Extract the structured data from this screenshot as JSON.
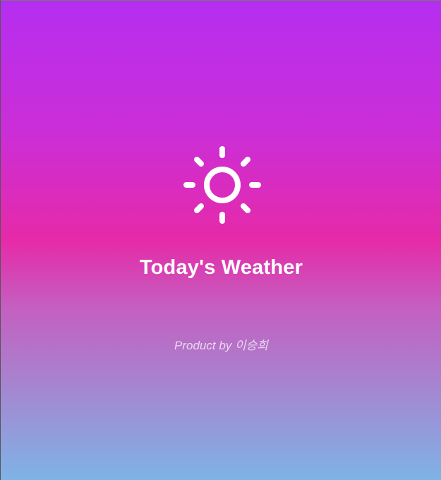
{
  "app": {
    "title": "Today's Weather",
    "credit": "Product by 이승희"
  },
  "icons": {
    "weather": "sun-icon"
  },
  "colors": {
    "gradient_top": "#b52ef0",
    "gradient_middle": "#e62aa8",
    "gradient_bottom": "#7fb3e6",
    "text": "#ffffff"
  }
}
